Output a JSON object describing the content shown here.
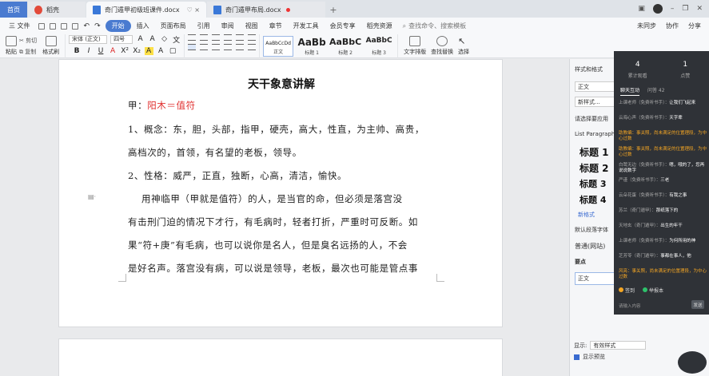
{
  "tabs": {
    "home": "首页",
    "shell": "稻壳",
    "active_doc": "奇门遁甲初级班课件.docx",
    "inactive_doc": "奇门遁甲布局.docx",
    "add": "+"
  },
  "menu": {
    "file": "三 文件",
    "items": [
      "开始",
      "插入",
      "页面布局",
      "引用",
      "审阅",
      "视图",
      "章节",
      "开发工具",
      "会员专享",
      "稻壳资源"
    ],
    "search": "查找命令、搜索模板",
    "right": [
      "未同步",
      "协作",
      "分享"
    ]
  },
  "ribbon": {
    "cut": "剪切",
    "copy": "复制",
    "paste": "粘贴",
    "format_painter": "格式刷",
    "font_name": "宋体 (正文)",
    "font_size": "四号",
    "bold": "B",
    "italic": "I",
    "underline": "U",
    "styles": [
      {
        "preview": "AaBbCcDd",
        "label": "正文"
      },
      {
        "preview": "AaBb",
        "label": "标题 1"
      },
      {
        "preview": "AaBbC",
        "label": "标题 2"
      },
      {
        "preview": "AaBbC",
        "label": "标题 3"
      }
    ],
    "text_layout": "文字排版",
    "find_replace": "查找替换",
    "select": "选择"
  },
  "document": {
    "title": "天干象意讲解",
    "lines": [
      {
        "prefix": "甲：",
        "highlight": "阳木＝值符"
      },
      {
        "text": "1、概念：东，胆，头部，指甲，硬壳，高大，性直，为主帅、高贵，"
      },
      {
        "text": "高档次的，首领，有名望的老板，领导。"
      },
      {
        "text": "2、性格：威严，正直，独断，心高，清洁，愉快。"
      },
      {
        "text": "    用神临甲（甲就是值符）的人，是当官的命，但必须是落宫没"
      },
      {
        "text": "有击刑门迫的情况下才行，有毛病时，轻者打折，严重时可反断。如"
      },
      {
        "text": "果“符+庚”有毛病，也可以说你是名人，但是臭名远扬的人，不会"
      },
      {
        "text": "是好名声。落宫没有病，可以说是领导，老板，最次也可能是管点事"
      }
    ]
  },
  "style_pane": {
    "header": "样式和格式",
    "current": "正文",
    "new_style": "新样式...",
    "apply_label": "请选择要应用",
    "list_paragraph": "List Paragraph",
    "headings": [
      "标题 1",
      "标题 2",
      "标题 3",
      "标题 4"
    ],
    "body_link": "新格式",
    "default_font": "默认段落字体",
    "normal_web": "普通(网站)",
    "main_point": "要点",
    "body_box": "正文",
    "show_label": "显示:",
    "show_value": "有效样式",
    "preview_label": "显示预览"
  },
  "chat_overlay": {
    "stats": [
      {
        "n": "4",
        "t": "累计观看"
      },
      {
        "n": "1",
        "t": "点赞"
      }
    ],
    "tabs": [
      "聊天互动",
      "问答 42"
    ],
    "messages": [
      {
        "u": "上课老师（免费听书手）：",
        "c": "让我们飞起来",
        "hl": false
      },
      {
        "u": "云海心声（免费听书手）：",
        "c": "天字辈",
        "hl": false
      },
      {
        "u": "助教编：事关照，尚未满足的位置理段，为中心过数",
        "c": "",
        "hl": true
      },
      {
        "u": "助教编：事关照，尚未满足的位置理段，为中心过数",
        "c": "",
        "hl": true
      },
      {
        "u": "白鹭无边（免费听书手）：",
        "c": "嗯，哦的了，您再说说数字",
        "hl": false
      },
      {
        "u": "严谨（免费听书手）：",
        "c": "三老",
        "hl": false
      },
      {
        "u": "云朵花蛋（免费听书手）：",
        "c": "有我之事",
        "hl": false
      },
      {
        "u": "苏兰（奇门遁甲）：",
        "c": "那纸落下的",
        "hl": false
      },
      {
        "u": "天地玄（奇门遁甲）：",
        "c": "出生的年干",
        "hl": false
      },
      {
        "u": "上课老师（免费听书手）：",
        "c": "为何所用的神",
        "hl": false
      },
      {
        "u": "芝芳苓（奇门遁甲）：",
        "c": "事都在事人，他",
        "hl": false
      },
      {
        "u": "风亮：事关照，尚未满足的位置理段，为中心过数",
        "c": "",
        "hl": true
      }
    ],
    "footer": [
      "签到",
      "举报本"
    ],
    "input_placeholder": "请输入内容",
    "send": "发送"
  }
}
